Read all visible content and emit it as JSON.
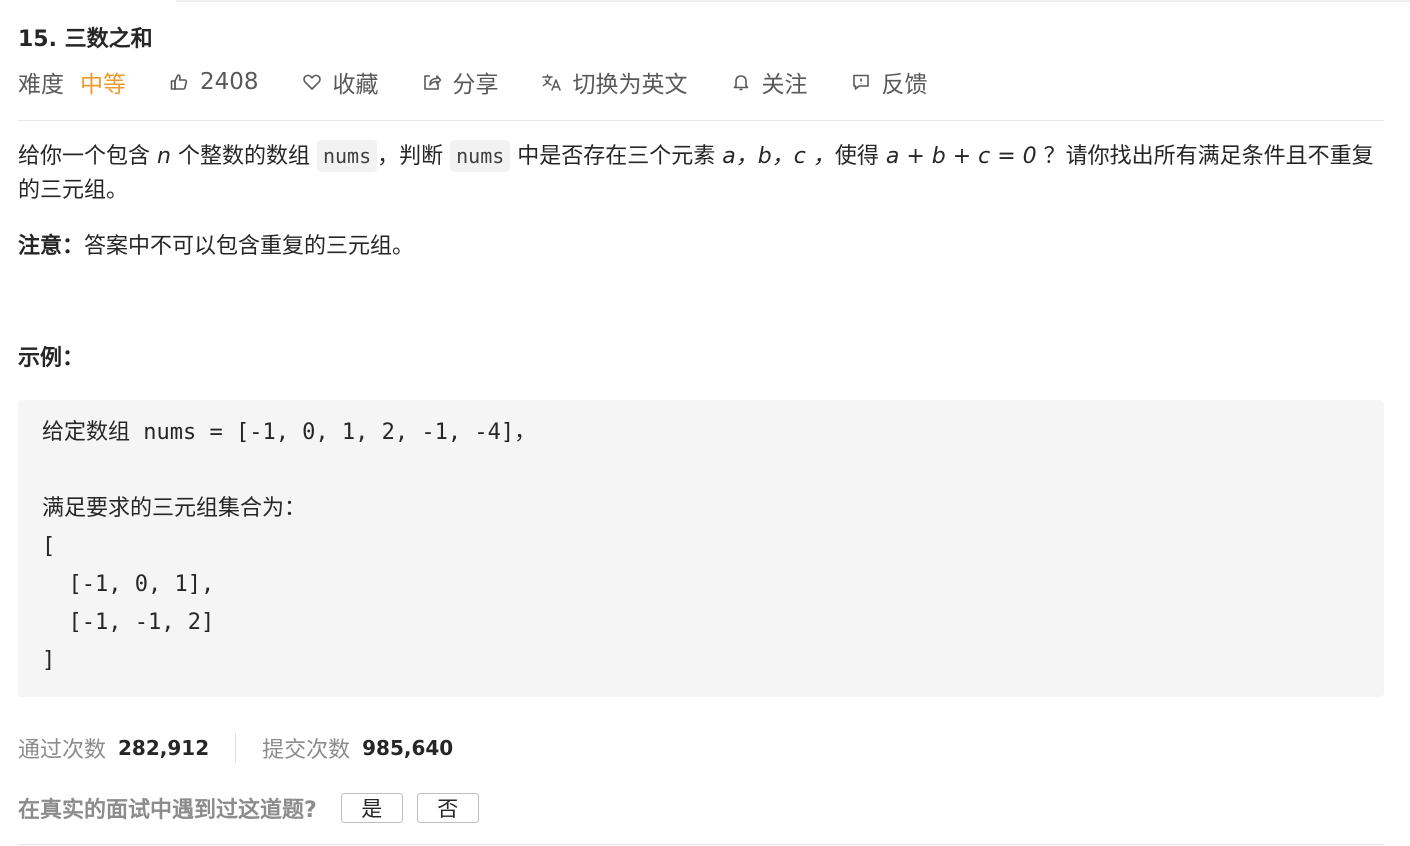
{
  "problem": {
    "title": "15. 三数之和",
    "difficulty_label": "难度",
    "difficulty_value": "中等",
    "likes": "2408",
    "favorite_label": "收藏",
    "share_label": "分享",
    "switch_lang_label": "切换为英文",
    "follow_label": "关注",
    "feedback_label": "反馈"
  },
  "description": {
    "part1": "给你一个包含 ",
    "var_n": "n",
    "part2": " 个整数的数组 ",
    "code_nums1": "nums",
    "part3": "，判断 ",
    "code_nums2": "nums",
    "part4": " 中是否存在三个元素 ",
    "var_abc": "a，b，c ，",
    "part5": "使得 ",
    "equation": "a + b + c = 0",
    "part6": " ？请你找出所有满足条件且不重复的三元组。"
  },
  "note": {
    "label": "注意：",
    "text": "答案中不可以包含重复的三元组。"
  },
  "example": {
    "title": "示例：",
    "lines": [
      "给定数组 nums = [-1, 0, 1, 2, -1, -4]，",
      "",
      "满足要求的三元组集合为：",
      "[",
      "  [-1, 0, 1],",
      "  [-1, -1, 2]",
      "]"
    ]
  },
  "stats": {
    "accepted_label": "通过次数",
    "accepted_value": "282,912",
    "submissions_label": "提交次数",
    "submissions_value": "985,640"
  },
  "interview": {
    "question": "在真实的面试中遇到过这道题?",
    "yes_label": "是",
    "no_label": "否"
  },
  "colors": {
    "difficulty_medium": "#ef9a2e",
    "muted_text": "#8c8c8c",
    "code_bg": "#f5f5f5"
  },
  "icons": {
    "likes": "thumbs-up-icon",
    "favorite": "heart-icon",
    "share": "share-icon",
    "translate": "translate-icon",
    "follow": "bell-icon",
    "feedback": "feedback-icon"
  }
}
